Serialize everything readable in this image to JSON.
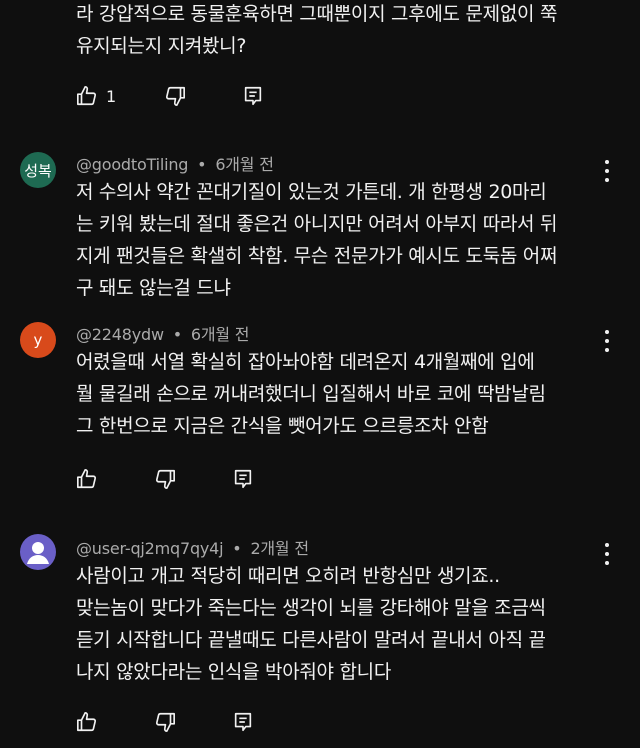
{
  "comments": [
    {
      "lines": [
        "라 강압적으로 동물훈육하면 그때뿐이지 그후에도 문제없이 쭉",
        "유지되는지 지켜봤니?"
      ],
      "like_count": "1"
    },
    {
      "avatar_text": "성복",
      "avatar_color": "#1e6a52",
      "author": "@goodtoTiling",
      "time": "6개월 전",
      "lines": [
        "저 수의사 약간 꼰대기질이 있는것 가튼데. 개 한평생 20마리",
        "는 키워 봤는데 절대 좋은건 아니지만 어려서 아부지 따라서 뒤",
        "지게 팬것들은 확샐히 착함. 무슨 전문가가 예시도 도둑돔 어쩌",
        "구 돼도 않는걸 드냐"
      ]
    },
    {
      "avatar_text": "y",
      "avatar_color": "#d84a1b",
      "author": "@2248ydw",
      "time": "6개월 전",
      "lines": [
        "어렸을때 서열 확실히 잡아놔야함 데려온지 4개월째에 입에",
        "뭘 물길래 손으로 꺼내려했더니 입질해서 바로 코에 딱밤날림",
        "그 한번으로 지금은 간식을 뺏어가도 으르릉조차 안함"
      ]
    },
    {
      "avatar_color": "#6a5fc7",
      "author": "@user-qj2mq7qy4j",
      "time": "2개월 전",
      "lines": [
        "사람이고 개고 적당히 때리면 오히려 반항심만 생기죠..",
        "맞는놈이 맞다가 죽는다는 생각이 뇌를 강타해야 말을 조금씩",
        "듣기 시작합니다 끝낼때도 다른사람이 말려서 끝내서 아직 끝",
        "나지 않았다라는 인식을 박아줘야 합니다"
      ]
    }
  ],
  "separator": "•",
  "icons": {
    "like": "thumbs-up-icon",
    "dislike": "thumbs-down-icon",
    "reply": "reply-icon",
    "more": "more-vertical-icon"
  }
}
